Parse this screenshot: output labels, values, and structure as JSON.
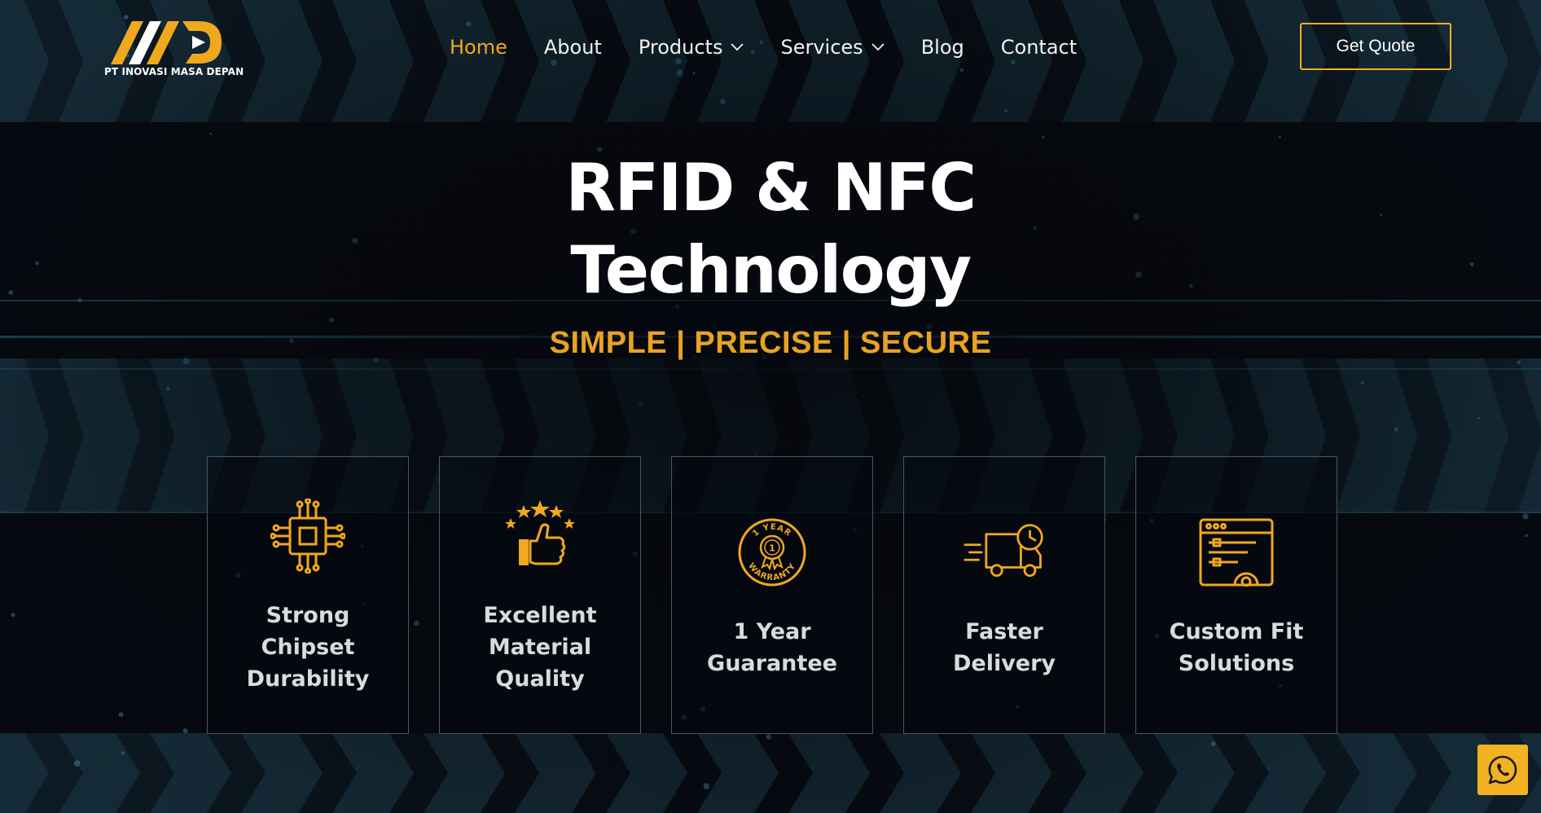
{
  "brand": {
    "company_name": "PT INOVASI MASA DEPAN",
    "accent_color": "#f0a81e"
  },
  "nav": {
    "items": [
      {
        "label": "Home",
        "active": true
      },
      {
        "label": "About"
      },
      {
        "label": "Products",
        "has_dropdown": true
      },
      {
        "label": "Services",
        "has_dropdown": true
      },
      {
        "label": "Blog"
      },
      {
        "label": "Contact"
      }
    ],
    "cta_label": "Get Quote"
  },
  "hero": {
    "title_line1": "RFID & NFC",
    "title_line2": "Technology",
    "tagline": "SIMPLE | PRECISE | SECURE"
  },
  "features": [
    {
      "icon": "chip-icon",
      "label": "Strong Chipset Durability"
    },
    {
      "icon": "thumbs-up-stars-icon",
      "label": "Excellent Material Quality"
    },
    {
      "icon": "warranty-badge-icon",
      "label": "1 Year Guarantee",
      "badge_top": "1 YEAR",
      "badge_bottom": "WARRANTY",
      "badge_number": "1"
    },
    {
      "icon": "delivery-truck-icon",
      "label": "Faster Delivery"
    },
    {
      "icon": "settings-window-icon",
      "label": "Custom Fit Solutions"
    }
  ],
  "whatsapp": {
    "icon": "whatsapp-icon",
    "color": "#f3b222"
  }
}
